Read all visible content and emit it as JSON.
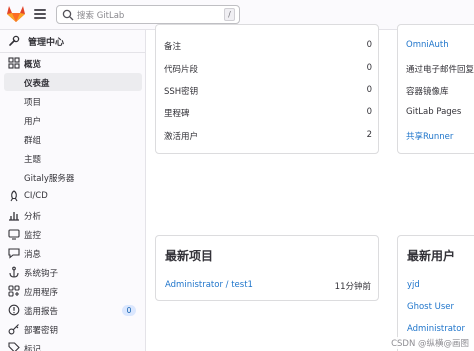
{
  "topbar": {
    "search_placeholder": "搜索 GitLab",
    "search_shortcut": "/",
    "logo_icon": "gitlab-tanuki-icon",
    "menu_icon": "hamburger-icon",
    "brand_color": "#e24329"
  },
  "sidebar": {
    "header": "管理中心",
    "items": [
      {
        "label": "概览",
        "icon": "grid-icon"
      },
      {
        "label": "仪表盘"
      },
      {
        "label": "项目"
      },
      {
        "label": "用户"
      },
      {
        "label": "群组"
      },
      {
        "label": "主题"
      },
      {
        "label": "Gitaly服务器"
      },
      {
        "label": "CI/CD",
        "icon": "rocket-icon"
      },
      {
        "label": "分析",
        "icon": "chart-icon"
      },
      {
        "label": "监控",
        "icon": "monitor-icon"
      },
      {
        "label": "消息",
        "icon": "message-icon"
      },
      {
        "label": "系统钩子",
        "icon": "anchor-icon"
      },
      {
        "label": "应用程序",
        "icon": "apps-icon"
      },
      {
        "label": "滥用报告",
        "icon": "alert-icon",
        "badge": "0"
      },
      {
        "label": "部署密钥",
        "icon": "key-icon"
      },
      {
        "label": "标记",
        "icon": "label-icon"
      }
    ]
  },
  "stats": [
    {
      "label": "备注",
      "value": "0"
    },
    {
      "label": "代码片段",
      "value": "0"
    },
    {
      "label": "SSH密钥",
      "value": "0"
    },
    {
      "label": "里程碑",
      "value": "0"
    },
    {
      "label": "激活用户",
      "value": "2"
    }
  ],
  "features": [
    {
      "label": "OmniAuth",
      "link": true
    },
    {
      "label": "通过电子邮件回复",
      "link": false
    },
    {
      "label": "容器镜像库",
      "link": false
    },
    {
      "label": "GitLab Pages",
      "link": false
    },
    {
      "label": "共享Runner",
      "link": true
    }
  ],
  "latest_projects": {
    "title": "最新项目",
    "rows": [
      {
        "name": "Administrator / test1",
        "time": "11分钟前"
      }
    ]
  },
  "latest_users": {
    "title": "最新用户",
    "users": [
      "yjd",
      "Ghost User",
      "Administrator"
    ]
  },
  "watermark": "CSDN @纵横@画图"
}
